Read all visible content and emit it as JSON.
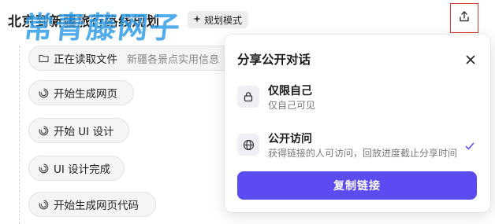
{
  "header": {
    "title": "北京到新疆旅行路线规划",
    "mode_badge": "规划模式",
    "watermark": "常青藤网子",
    "share_icon": "upload-share-icon"
  },
  "steps": [
    {
      "icon": "folder-icon",
      "label": "正在读取文件",
      "sub": "新疆各景点实用信息"
    },
    {
      "icon": "spinner-icon",
      "label": "开始生成网页"
    },
    {
      "icon": "spinner-icon",
      "label": "开始 UI 设计"
    },
    {
      "icon": "spinner-icon",
      "label": "UI 设计完成"
    },
    {
      "icon": "spinner-icon",
      "label": "开始生成网页代码"
    }
  ],
  "share_dialog": {
    "title": "分享公开对话",
    "options": [
      {
        "icon": "lock-icon",
        "name": "仅限自己",
        "desc": "仅自己可见",
        "selected": false
      },
      {
        "icon": "globe-icon",
        "name": "公开访问",
        "desc": "获得链接的人可访问，回放进度截止分享时间",
        "selected": true
      }
    ],
    "copy_button": "复制链接"
  },
  "colors": {
    "accent": "#5b4bf0",
    "highlight_border": "#d9382f",
    "watermark": "#2a9be6"
  }
}
